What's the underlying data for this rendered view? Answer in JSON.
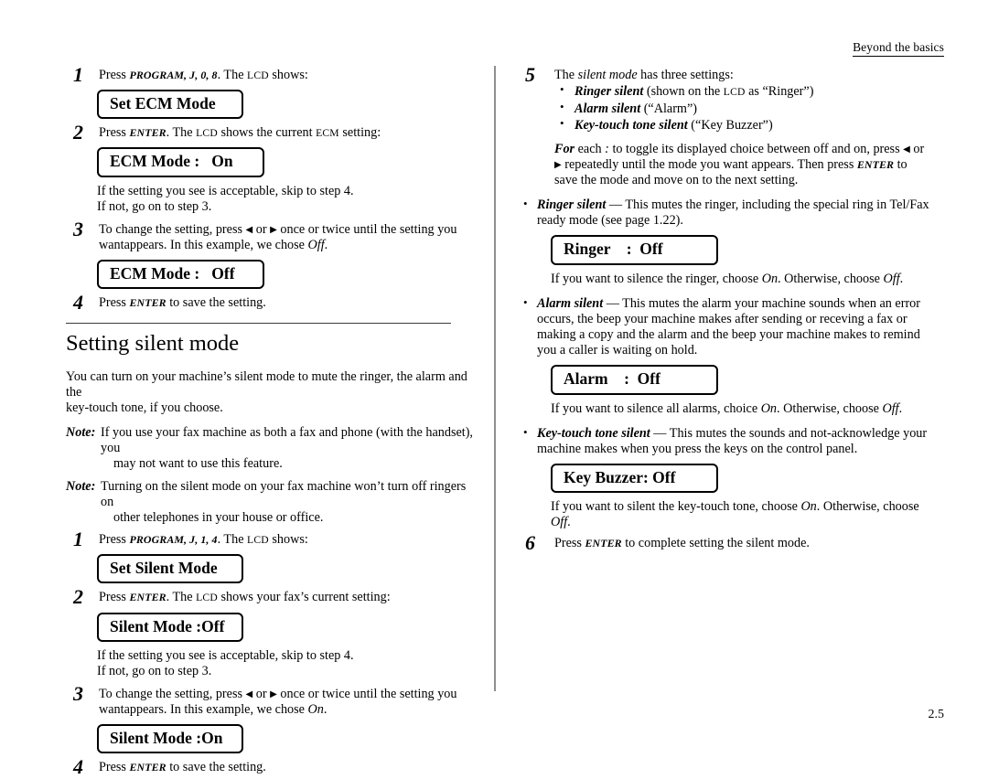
{
  "header": {
    "running_head": "Beyond the basics"
  },
  "folio": {
    "page_number": "2.5"
  },
  "left_column": {
    "ecm_steps": [
      {
        "num": "1",
        "text_pre": "Press ",
        "keys": "PROGRAM, J, 0, 8",
        "text_post": ". The ",
        "sc": "LCD",
        "text_end": " shows:"
      },
      {
        "num": "2",
        "text_pre": "Press ",
        "keys": "ENTER",
        "text_post": ". The ",
        "sc": "LCD",
        "text_mid": " shows the current ",
        "sc2": "ECM",
        "text_end": " setting:"
      }
    ],
    "lcd_set_ecm": "Set ECM Mode",
    "lcd_ecm_on": "ECM Mode :   On",
    "accept_line_1": "If the setting you see is acceptable, skip to step 4.",
    "accept_line_2": "If not, go on to step 3.",
    "step3": {
      "num": "3",
      "line1_a": "To change the setting, press ",
      "arrow_left": "◀",
      "line1_or": " or ",
      "arrow_right": "▶",
      "line1_b": " once or twice until the setting you want",
      "line2_a": "appears. In this example, we chose ",
      "line2_choice": "Off",
      "line2_b": "."
    },
    "lcd_ecm_off": "ECM Mode :   Off",
    "step4": {
      "num": "4",
      "text_pre": "Press ",
      "keys": "ENTER",
      "text_post": " to save the setting."
    },
    "section_title": "Setting silent mode",
    "intro_line1": "You can turn on your machine’s silent mode to mute the ringer, the alarm and the",
    "intro_line2": "key-touch tone, if you choose.",
    "notes": [
      {
        "label": "Note:",
        "line1": "If you use your fax machine as both a fax and phone (with the handset), you",
        "line2": "may not want to use this feature."
      },
      {
        "label": "Note:",
        "line1": "Turning on the silent mode on your fax machine won’t turn off ringers on",
        "line2": "other telephones in your house or office."
      }
    ],
    "silent_steps": [
      {
        "num": "1",
        "text_pre": "Press ",
        "keys": "PROGRAM, J, 1, 4",
        "text_post": ".  The ",
        "sc": "LCD",
        "text_end": " shows:"
      },
      {
        "num": "2",
        "text_pre": "Press ",
        "keys": "ENTER",
        "text_post": ".  The ",
        "sc": "LCD",
        "text_end": " shows your fax’s current setting:"
      }
    ],
    "lcd_set_silent": "Set Silent Mode",
    "lcd_silent_off": "Silent Mode :Off",
    "accept2_line_1": "If the setting you see is acceptable, skip to step 4.",
    "accept2_line_2": "If not, go on to step 3.",
    "step3b": {
      "num": "3",
      "line1_a": "To change the setting, press ",
      "arrow_left": "◀",
      "line1_or": " or ",
      "arrow_right": "▶",
      "line1_b": " once or twice until the setting you want",
      "line2_a": "appears. In this example, we chose ",
      "line2_choice": "On",
      "line2_b": "."
    },
    "lcd_silent_on": "Silent Mode :On",
    "step4b": {
      "num": "4",
      "text_pre": "Press ",
      "keys": "ENTER",
      "text_post": " to save the setting."
    }
  },
  "right_column": {
    "step5": {
      "num": "5",
      "lead_a": "The ",
      "lead_it": "silent mode",
      "lead_b": " has three settings:",
      "settings": [
        {
          "name": "Ringer silent",
          "detail_a": " (shown on the ",
          "sc": "LCD",
          "detail_b": " as “Ringer”)"
        },
        {
          "name": "Alarm silent",
          "detail_a": " (“Alarm”)",
          "sc": "",
          "detail_b": ""
        },
        {
          "name": "Key-touch tone silent",
          "detail_a": "  (“Key Buzzer”)",
          "sc": "",
          "detail_b": ""
        }
      ],
      "for_each": {
        "bold_word": "For",
        "line1_a": " each ",
        "colon": ":",
        "line1_b": " to toggle its displayed choice between off and on, press ",
        "arrow_left": "◀",
        "line1_or": " or ",
        "arrow_right": "▶",
        "line2_a": "repeatedly until the mode you want appears. Then press ",
        "keys": "ENTER",
        "line2_b": " to save the",
        "line3": "mode and move on to the next setting."
      }
    },
    "ringer_bullet": {
      "name": "Ringer silent",
      "dash": " — ",
      "line1": "This mutes the ringer, including the special ring in Tel/Fax",
      "line2": "ready mode (see page 1.22)."
    },
    "lcd_ringer": "Ringer    :  Off",
    "ringer_follow_a": "If you want to silence the ringer, choose ",
    "ringer_follow_on": "On",
    "ringer_follow_b": ". Otherwise, choose ",
    "ringer_follow_off": "Off",
    "ringer_follow_c": ".",
    "alarm_bullet": {
      "name": "Alarm silent",
      "dash": " — ",
      "line1": "This mutes the alarm your machine sounds when an error",
      "line2": "occurs, the beep your machine makes after sending or receving a fax or making a",
      "line3": "copy and the alarm and the beep your machine makes to remind you a caller is",
      "line4": "waiting on hold."
    },
    "lcd_alarm": "Alarm    :  Off",
    "alarm_follow_a": "If you want to silence all alarms, choice ",
    "alarm_follow_on": "On",
    "alarm_follow_b": ". Otherwise, choose ",
    "alarm_follow_off": "Off",
    "alarm_follow_c": ".",
    "keytouch_bullet": {
      "name": "Key-touch tone silent",
      "dash": "  — ",
      "line1": "This mutes the sounds and not-acknowledge your",
      "line2": "machine makes when you press the keys on the control panel."
    },
    "lcd_key_buzzer": "Key Buzzer: Off",
    "key_follow_a": "If you want to silent the key-touch tone, choose ",
    "key_follow_on": "On",
    "key_follow_b": ". Otherwise, choose ",
    "key_follow_off": "Off",
    "key_follow_c": ".",
    "step6": {
      "num": "6",
      "text_pre": "Press ",
      "keys": "ENTER",
      "text_post": " to complete setting the silent mode."
    }
  }
}
